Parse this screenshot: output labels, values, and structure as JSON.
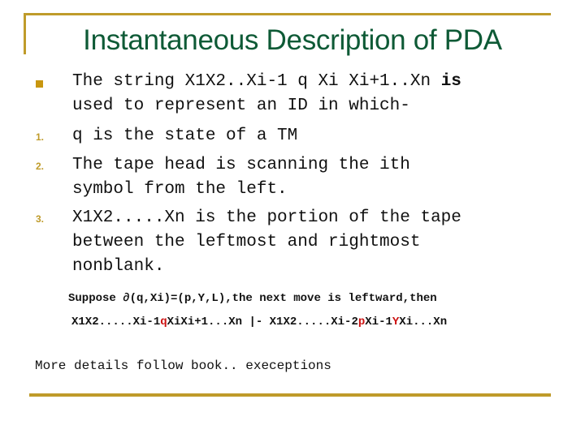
{
  "slide": {
    "title": "Instantaneous Description of PDA",
    "accent_color": "#bf9b2a",
    "title_color": "#0e5a36",
    "bullet": {
      "lines": [
        "The string X1X2..Xi-1 q Xi Xi+1..Xn ",
        "used to represent an ID in which-"
      ],
      "bold_tail": "is"
    },
    "numbered_items": [
      {
        "marker": "1.",
        "lines": [
          "q is the state of a TM"
        ]
      },
      {
        "marker": "2.",
        "lines": [
          "The tape head is scanning the ith",
          "symbol from the left."
        ]
      },
      {
        "marker": "3.",
        "lines": [
          "X1X2.....Xn is the portion of the tape",
          "between the leftmost and rightmost",
          "nonblank."
        ]
      }
    ],
    "suppose_line": "Suppose ∂(q,Xi)=(p,Y,L),the next move is leftward,then",
    "transition": {
      "part1": "X1X2.....Xi-1",
      "state_q": "q",
      "part2": "XiXi+1...Xn |- X1X2.....Xi-2",
      "state_p": "p",
      "part3": "Xi-1",
      "symbol_y": "Y",
      "part4": "Xi...Xn",
      "highlight_color": "#cc1111"
    },
    "more_details": "More details follow book.. execeptions"
  }
}
